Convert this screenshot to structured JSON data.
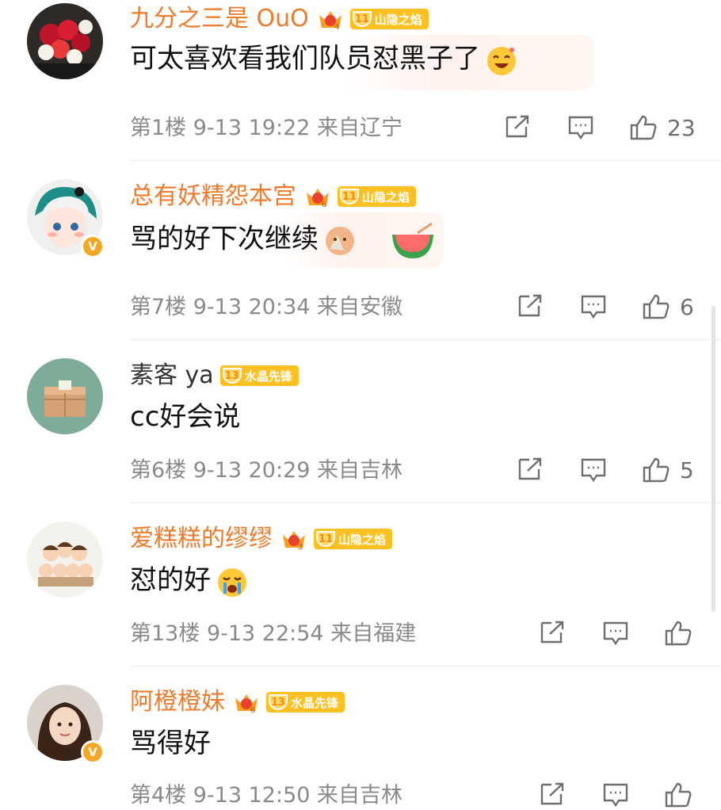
{
  "comments": [
    {
      "name": "九分之三是 OuO",
      "name_color": "orange",
      "crown_level": "4",
      "fan_level": "11",
      "fan_title": "山隐之焰",
      "text": "可太喜欢看我们队员怼黑子了",
      "emoji": "grin-emoji",
      "meta": "第1楼  9-13  19:22  来自辽宁",
      "likes": "23",
      "verified": false
    },
    {
      "name": "总有妖精怨本宫",
      "name_color": "orange",
      "crown_level": "6",
      "fan_level": "11",
      "fan_title": "山隐之焰",
      "text": "骂的好下次继续",
      "emoji": "fan-emoji",
      "meta": "第7楼  9-13  20:34  来自安徽",
      "likes": "6",
      "verified": true
    },
    {
      "name": "素客 ya",
      "name_color": "grey",
      "crown_level": "",
      "fan_level": "13",
      "fan_title": "水晶先锋",
      "text": "cc好会说",
      "emoji": "",
      "meta": "第6楼  9-13  20:29  来自吉林",
      "likes": "5",
      "verified": false
    },
    {
      "name": "爱糕糕的缪缪",
      "name_color": "orange",
      "crown_level": "3",
      "fan_level": "11",
      "fan_title": "山隐之焰",
      "text": "怼的好",
      "emoji": "crying-emoji",
      "meta": "第13楼  9-13  22:54  来自福建",
      "likes": "",
      "verified": false
    },
    {
      "name": "阿橙橙妹",
      "name_color": "orange",
      "crown_level": "6",
      "fan_level": "13",
      "fan_title": "水晶先锋",
      "text": "骂得好",
      "emoji": "",
      "meta": "第4楼  9-13  12:50  来自吉林",
      "likes": "",
      "verified": true
    }
  ],
  "verified_mark": "V"
}
